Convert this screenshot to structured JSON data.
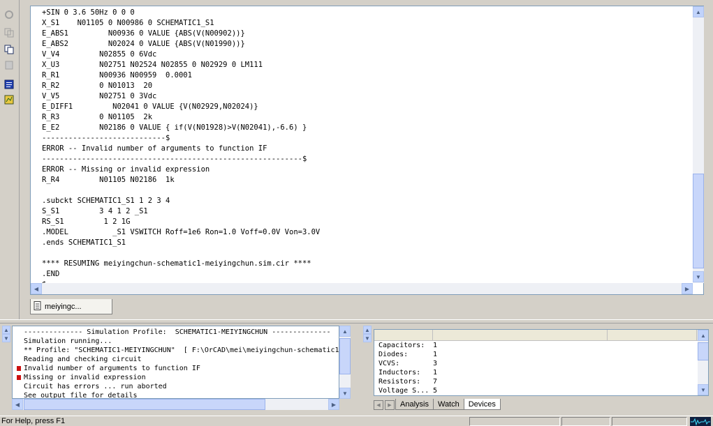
{
  "editor": {
    "lines": [
      "+SIN 0 3.6 50Hz 0 0 0",
      "X_S1    N01105 0 N00986 0 SCHEMATIC1_S1",
      "E_ABS1         N00936 0 VALUE {ABS(V(N00902))}",
      "E_ABS2         N02024 0 VALUE {ABS(V(N01990))}",
      "V_V4         N02855 0 6Vdc",
      "X_U3         N02751 N02524 N02855 0 N02929 0 LM111",
      "R_R1         N00936 N00959  0.0001",
      "R_R2         0 N01013  20",
      "V_V5         N02751 0 3Vdc",
      "E_DIFF1         N02041 0 VALUE {V(N02929,N02024)}",
      "R_R3         0 N01105  2k",
      "E_E2         N02186 0 VALUE { if(V(N01928)>V(N02041),-6.6) }",
      "----------------------------$",
      "ERROR -- Invalid number of arguments to function IF",
      "-----------------------------------------------------------$",
      "ERROR -- Missing or invalid expression",
      "R_R4         N01105 N02186  1k",
      "",
      ".subckt SCHEMATIC1_S1 1 2 3 4",
      "S_S1         3 4 1 2 _S1",
      "RS_S1         1 2 1G",
      ".MODEL          _S1 VSWITCH Roff=1e6 Ron=1.0 Voff=0.0V Von=3.0V",
      ".ends SCHEMATIC1_S1",
      "",
      "**** RESUMING meiyingchun-schematic1-meiyingchun.sim.cir ****",
      ".END",
      "$"
    ]
  },
  "file_tab": {
    "label": "meiyingc..."
  },
  "simulation": {
    "lines": [
      {
        "text": "-------------- Simulation Profile:  SCHEMATIC1-MEIYINGCHUN --------------",
        "error": false
      },
      {
        "text": "Simulation running...",
        "error": false
      },
      {
        "text": "** Profile: \"SCHEMATIC1-MEIYINGCHUN\"  [ F:\\OrCAD\\mei\\meiyingchun-schematic1",
        "error": false
      },
      {
        "text": "Reading and checking circuit",
        "error": false
      },
      {
        "text": "Invalid number of arguments to function IF",
        "error": true
      },
      {
        "text": "Missing or invalid expression",
        "error": true
      },
      {
        "text": "Circuit has errors ... run aborted",
        "error": false
      },
      {
        "text": "See output file for details",
        "error": false
      }
    ]
  },
  "devices": {
    "rows": [
      {
        "name": "Capacitors:",
        "count": "1"
      },
      {
        "name": "Diodes:",
        "count": "1"
      },
      {
        "name": "VCVS:",
        "count": "3"
      },
      {
        "name": "Inductors:",
        "count": "1"
      },
      {
        "name": "Resistors:",
        "count": "7"
      },
      {
        "name": "Voltage S...",
        "count": "5"
      }
    ]
  },
  "bottom_tabs": [
    "Analysis",
    "Watch",
    "Devices"
  ],
  "status": {
    "help_text": "For Help, press F1"
  },
  "colors": {
    "error_marker": "#cc1010",
    "scroll_button": "#c1d3fb"
  }
}
